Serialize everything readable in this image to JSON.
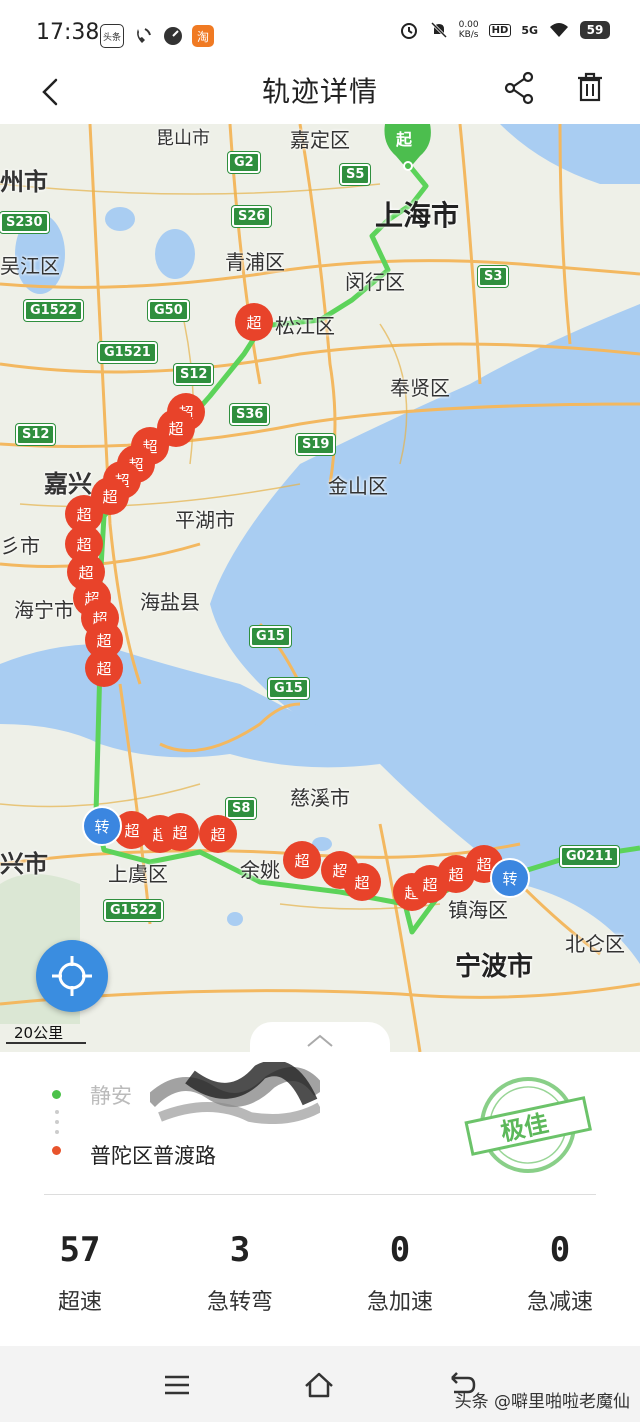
{
  "status_bar": {
    "time": "17:38",
    "net_speed": "0.00",
    "net_unit": "KB/s",
    "hd": "HD",
    "network": "5G",
    "battery": "59",
    "app_toutiao": "头条",
    "app_taobao": "淘"
  },
  "header": {
    "title": "轨迹详情",
    "back_icon": "chevron-left-icon",
    "share_icon": "share-icon",
    "delete_icon": "trash-icon"
  },
  "map": {
    "route_color": "#5cd35a",
    "speeding_marker_color": "#e8432a",
    "turn_marker_color": "#3b86e0",
    "speeding_marker_label": "超",
    "turn_marker_label": "转",
    "start_pin_label": "起",
    "scale": "20公里",
    "place_labels": [
      "嘉定区",
      "上海市",
      "闵行区",
      "青浦区",
      "松江区",
      "奉贤区",
      "吴江区",
      "州市",
      "嘉兴",
      "平湖市",
      "金山区",
      "海宁市",
      "海盐县",
      "彡市",
      "慈溪市",
      "上虞区",
      "余姚",
      "镇海区",
      "宁波市",
      "北仑区",
      "兴市",
      "毘山市"
    ],
    "road_shields": [
      "G2",
      "S5",
      "S26",
      "S230",
      "G1522",
      "G50",
      "G1521",
      "S12",
      "S36",
      "S19",
      "S3",
      "G15",
      "S8",
      "G0211"
    ]
  },
  "trip": {
    "start_address": "静安",
    "end_address": "普陀区普渡路",
    "rating": "极佳"
  },
  "stats": [
    {
      "value": "57",
      "label": "超速"
    },
    {
      "value": "3",
      "label": "急转弯"
    },
    {
      "value": "0",
      "label": "急加速"
    },
    {
      "value": "0",
      "label": "急减速"
    }
  ],
  "navbar": {
    "menu_icon": "menu-icon",
    "home_icon": "home-icon",
    "back_icon": "back-icon"
  },
  "watermark": "头条 @噼里啪啦老魔仙"
}
